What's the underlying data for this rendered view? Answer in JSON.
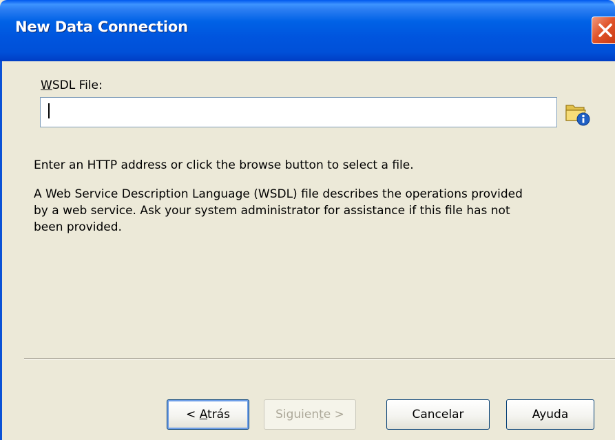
{
  "window": {
    "title": "New Data Connection"
  },
  "form": {
    "wsdl_label_accel": "W",
    "wsdl_label_rest": "SDL File:",
    "wsdl_value": "",
    "browse_icon": "folder-info-icon"
  },
  "help": {
    "line1": "Enter an HTTP address or click the browse button to select a file.",
    "para_lines": [
      "A Web Service Description Language (WSDL) file describes the operations provided",
      "by a web service.  Ask your system administrator for assistance if this file has not",
      "been provided."
    ]
  },
  "buttons": {
    "back_prefix": "< ",
    "back_accel": "A",
    "back_rest": "trás",
    "next_prefix": "Siguien",
    "next_accel": "t",
    "next_rest": "e >",
    "cancel": "Cancelar",
    "help": "Ayuda"
  },
  "colors": {
    "titlebar": "#0055de",
    "dialog_bg": "#ece9d8",
    "close_button": "#e0542a",
    "input_border": "#7f9db9",
    "disabled_text": "#aca899"
  }
}
